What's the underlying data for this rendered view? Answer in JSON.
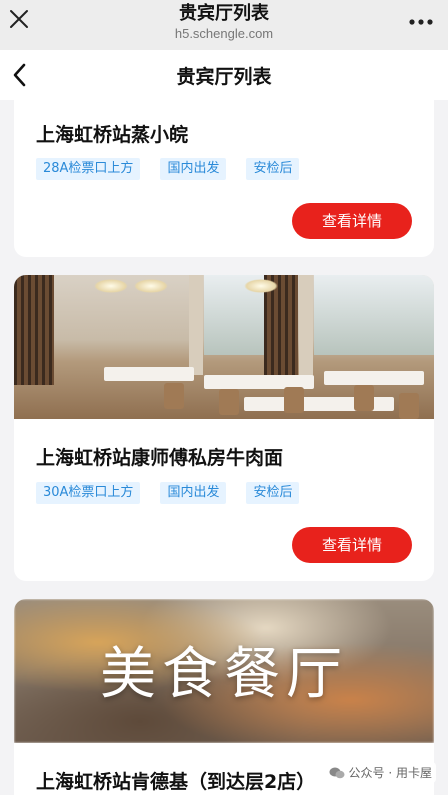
{
  "browser": {
    "title": "贵宾厅列表",
    "url": "h5.schengle.com"
  },
  "header": {
    "title": "贵宾厅列表"
  },
  "lounges": [
    {
      "name": "上海虹桥站蒸小皖",
      "tags": [
        "28A检票口上方",
        "国内出发",
        "安检后"
      ],
      "button": "查看详情"
    },
    {
      "name": "上海虹桥站康师傅私房牛肉面",
      "tags": [
        "30A检票口上方",
        "国内出发",
        "安检后"
      ],
      "button": "查看详情"
    },
    {
      "name": "上海虹桥站肯德基（到达层2店）",
      "image_text": "美食餐厅"
    }
  ],
  "watermark": {
    "text": "公众号 · 用卡屋"
  },
  "colors": {
    "accent": "#e8221c",
    "tag_bg": "#e6f3ff",
    "tag_text": "#2a8ad8"
  }
}
